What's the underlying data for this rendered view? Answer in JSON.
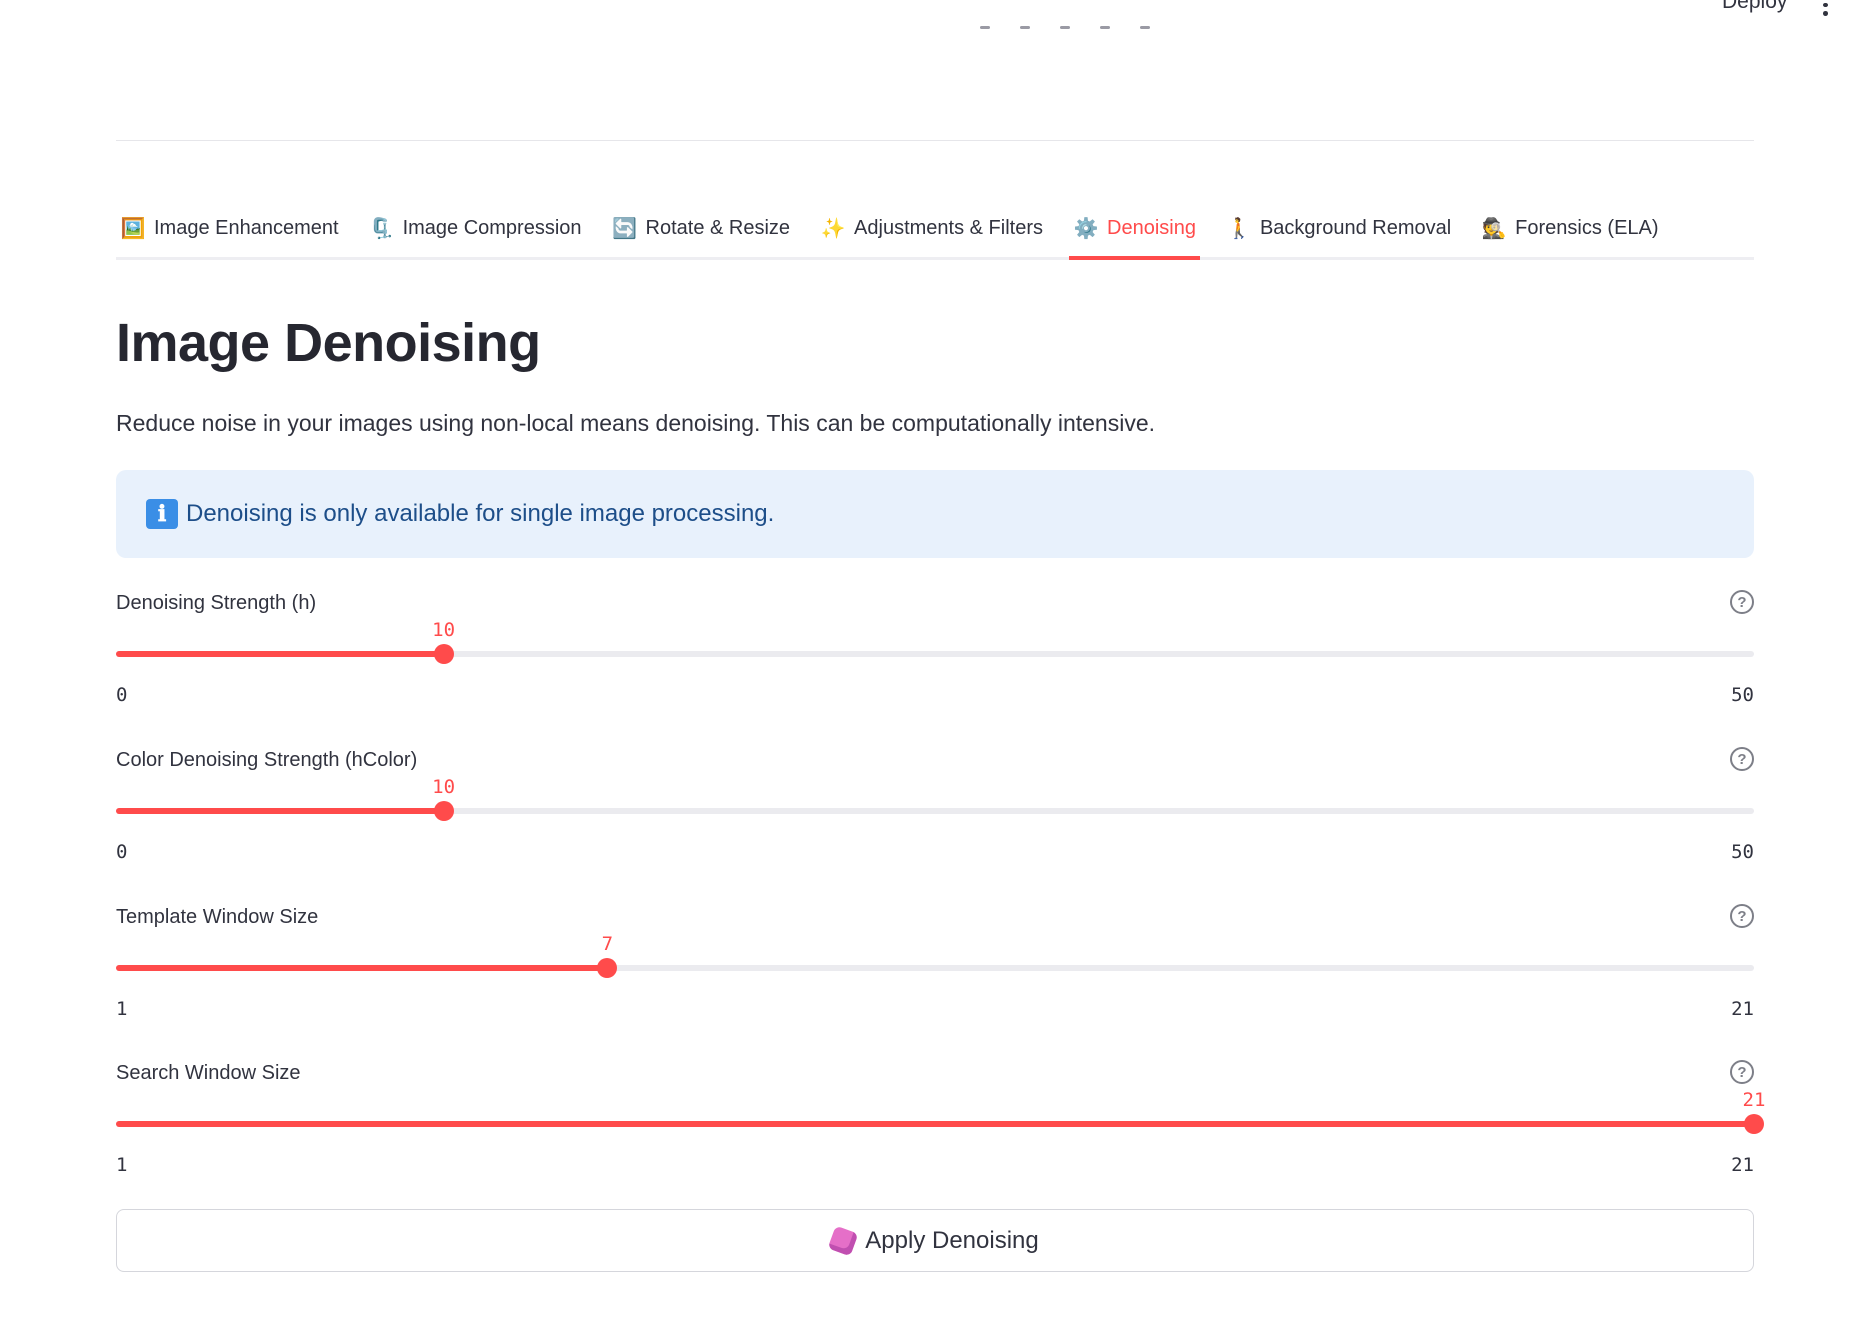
{
  "header": {
    "deploy_label": "Deploy",
    "menu_icon": "more-vertical-icon"
  },
  "tabs": [
    {
      "label": "Image Enhancement",
      "emoji": "🖼️"
    },
    {
      "label": "Image Compression",
      "emoji": "🗜️"
    },
    {
      "label": "Rotate & Resize",
      "emoji": "🔄"
    },
    {
      "label": "Adjustments & Filters",
      "emoji": "✨"
    },
    {
      "label": "Denoising",
      "emoji": "⚙️",
      "active": true
    },
    {
      "label": "Background Removal",
      "emoji": "🚶"
    },
    {
      "label": "Forensics (ELA)",
      "emoji": "🕵️"
    }
  ],
  "main": {
    "title": "Image Denoising",
    "description": "Reduce noise in your images using non-local means denoising. This can be computationally intensive.",
    "info_icon": "ℹ",
    "info_text": "Denoising is only available for single image processing."
  },
  "sliders": [
    {
      "label": "Denoising Strength (h)",
      "min": 0,
      "max": 50,
      "value": 10
    },
    {
      "label": "Color Denoising Strength (hColor)",
      "min": 0,
      "max": 50,
      "value": 10
    },
    {
      "label": "Template Window Size",
      "min": 1,
      "max": 21,
      "value": 7
    },
    {
      "label": "Search Window Size",
      "min": 1,
      "max": 21,
      "value": 21
    }
  ],
  "apply_button": {
    "label": "Apply Denoising",
    "icon": "gem-icon"
  },
  "colors": {
    "accent": "#ff4b4b",
    "info_bg": "#e8f1fc",
    "info_text": "#1d4e89",
    "track": "#ebebef"
  }
}
